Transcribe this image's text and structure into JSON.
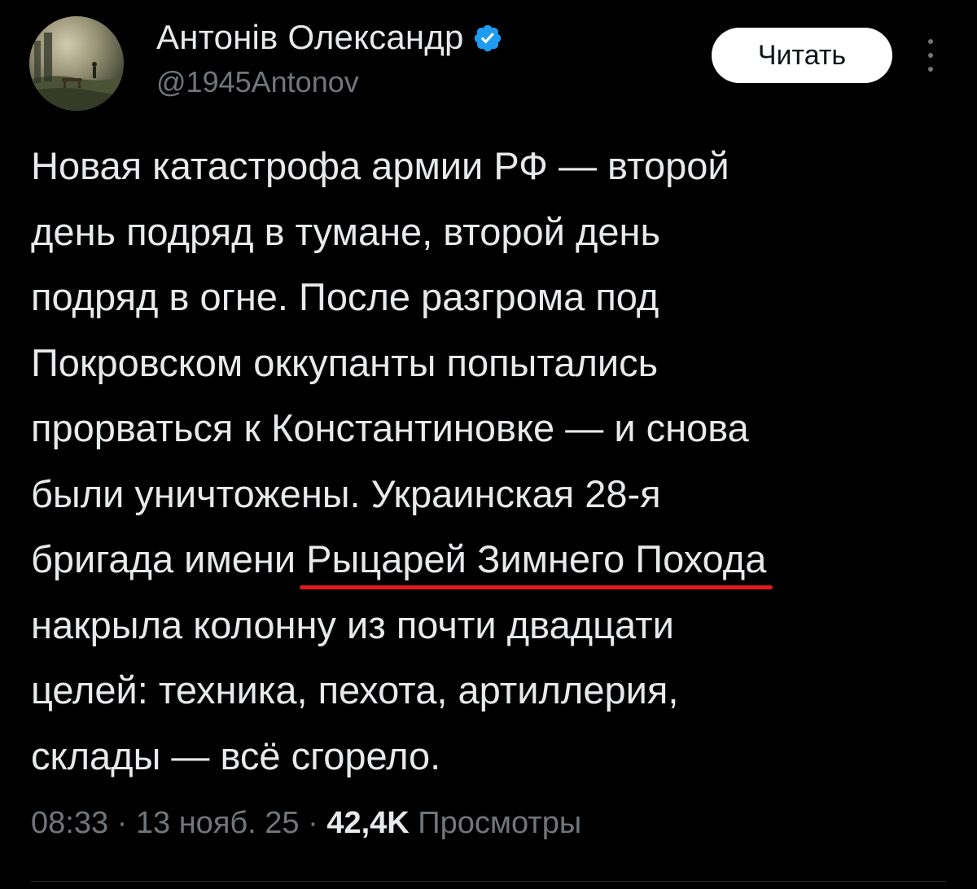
{
  "author": {
    "name": "Антонів Олександр",
    "handle": "@1945Antonov",
    "verified": true
  },
  "actions": {
    "follow_label": "Читать",
    "more_icon": "more-vertical-icon"
  },
  "post": {
    "lines": [
      "Новая катастрофа армии РФ — второй",
      "день подряд в тумане, второй день",
      "подряд в огне. После разгрома под",
      "Покровском оккупанты попытались",
      "прорваться к Константиновке — и снова",
      "были уничтожены. Украинская 28-я"
    ],
    "line7_prefix": "бригада имени ",
    "line7_highlight": "Рыцарей Зимнего Похода",
    "lines_after": [
      "накрыла колонну из почти двадцати",
      "целей: техника, пехота, артиллерия,",
      "склады — всё сгорело."
    ]
  },
  "meta": {
    "time": "08:33",
    "separator": " · ",
    "date": "13 нояб. 25",
    "views_count": "42,4K",
    "views_label": "Просмотры"
  },
  "colors": {
    "background": "#000000",
    "text": "#e7e9ea",
    "secondary": "#71767b",
    "verified_badge": "#1d9bf0",
    "highlight_underline": "#e01a1a",
    "follow_button_bg": "#ffffff"
  }
}
